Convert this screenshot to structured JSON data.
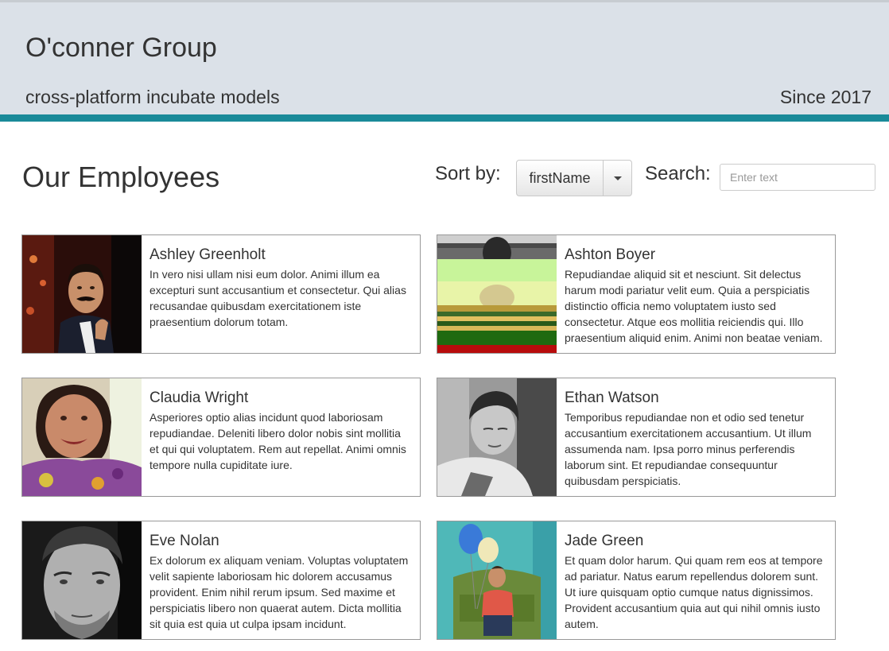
{
  "header": {
    "company_name": "O'conner Group",
    "tagline": "cross-platform incubate models",
    "since": "Since 2017",
    "background_color": "#dbe1e8",
    "accent_color": "#1a8a99"
  },
  "main": {
    "title": "Our Employees",
    "sort": {
      "label": "Sort by:",
      "selected": "firstName"
    },
    "search": {
      "label": "Search:",
      "placeholder": "Enter text",
      "value": ""
    }
  },
  "employees": [
    {
      "name": "Ashley Greenholt",
      "bio": "In vero nisi ullam nisi eum dolor. Animi illum ea excepturi sunt accusantium et consectetur. Qui alias recusandae quibusdam exercitationem iste praesentium dolorum totam.",
      "photo": "portrait-man-mustache-suit"
    },
    {
      "name": "Ashton Boyer",
      "bio": "Repudiandae aliquid sit et nesciunt. Sit delectus harum modi pariatur velit eum. Quia a perspiciatis distinctio officia nemo voluptatem iusto sed consectetur. Atque eos mollitia reiciendis qui. Illo praesentium aliquid enim. Animi non beatae veniam.",
      "photo": "portrait-glitched-striped-shirt"
    },
    {
      "name": "Claudia Wright",
      "bio": "Asperiores optio alias incidunt quod laboriosam repudiandae. Deleniti libero dolor nobis sint mollitia et qui qui voluptatem. Rem aut repellat. Animi omnis tempore nulla cupiditate iure.",
      "photo": "portrait-woman-smiling"
    },
    {
      "name": "Ethan Watson",
      "bio": "Temporibus repudiandae non et odio sed tenetur accusantium exercitationem accusantium. Ut illum assumenda nam. Ipsa porro minus perferendis laborum sint. Et repudiandae consequuntur quibusdam perspiciatis.",
      "photo": "portrait-man-looking-down-bw"
    },
    {
      "name": "Eve Nolan",
      "bio": "Ex dolorum ex aliquam veniam. Voluptas voluptatem velit sapiente laboriosam hic dolorem accusamus provident. Enim nihil rerum ipsum. Sed maxime et perspiciatis libero non quaerat autem. Dicta mollitia sit quia est quia ut culpa ipsam incidunt.",
      "photo": "portrait-man-bw-closeup"
    },
    {
      "name": "Jade Green",
      "bio": "Et quam dolor harum. Qui quam rem eos at tempore ad pariatur. Natus earum repellendus dolorem sunt. Ut iure quisquam optio cumque natus dignissimos. Provident accusantium quia aut qui nihil omnis iusto autem.",
      "photo": "portrait-man-balloons-chair"
    }
  ]
}
